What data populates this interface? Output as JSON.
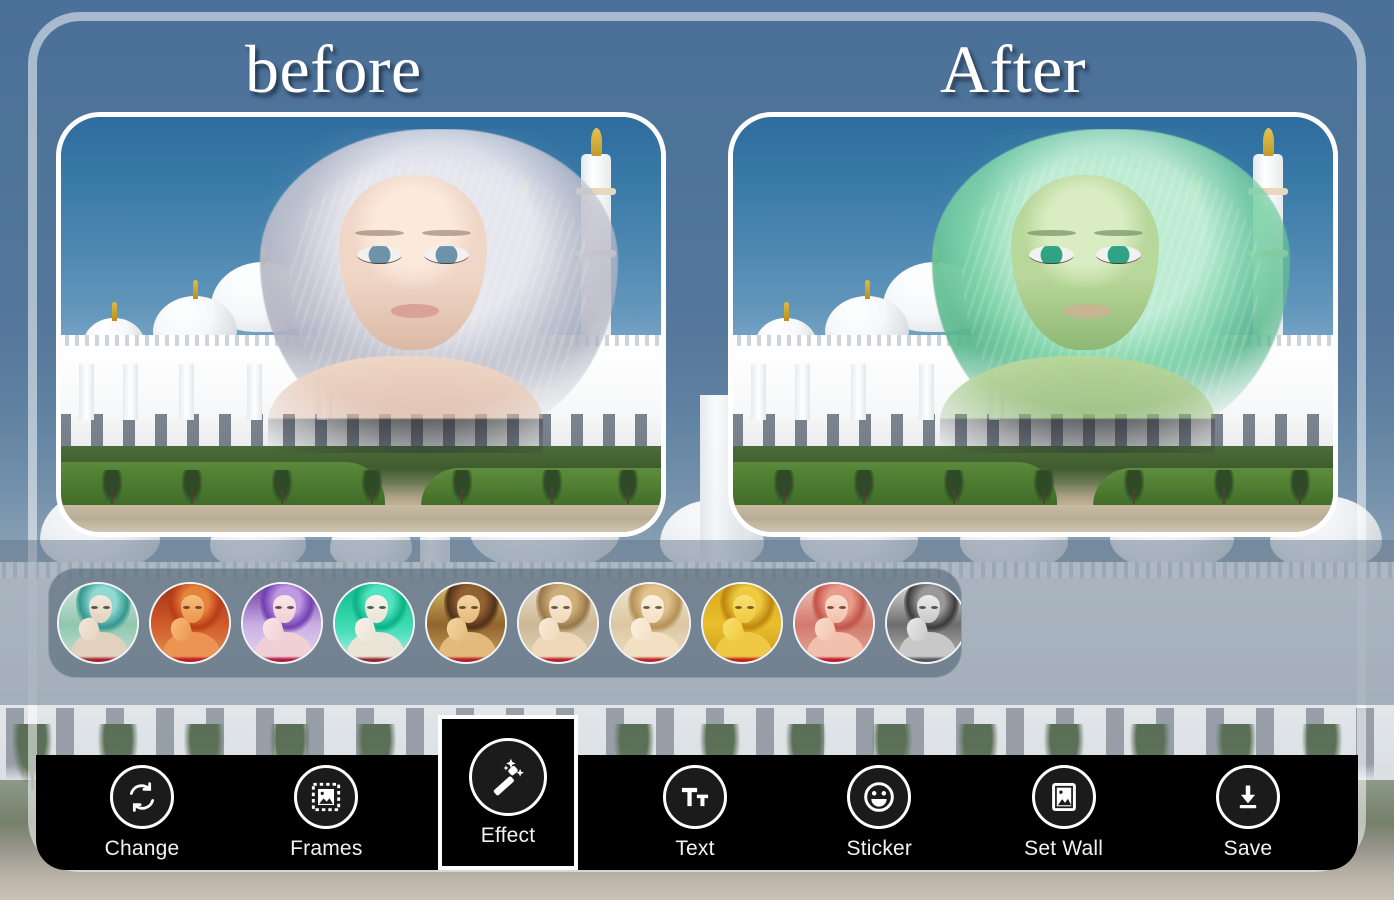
{
  "app": {
    "type": "photo-editor",
    "background_subject": "sheikh-zayed-grand-mosque"
  },
  "headings": {
    "before": "before",
    "after": "After"
  },
  "preview": {
    "left_panel": {
      "name": "before-preview",
      "label": "before",
      "overlay_subject": "woman-portrait",
      "hair_color": "#c6c6d2",
      "filter_applied": "none"
    },
    "right_panel": {
      "name": "after-preview",
      "label": "After",
      "overlay_subject": "woman-portrait",
      "hair_color": "#7fd3a9",
      "filter_applied": "green"
    }
  },
  "filter_strip": {
    "name": "effect-filter-thumbnails",
    "selected_index": 3,
    "items": [
      {
        "id": "filter-1",
        "name": "teal-green",
        "accent": "#6fb6a4"
      },
      {
        "id": "filter-2",
        "name": "warm-rust",
        "accent": "#b8542f"
      },
      {
        "id": "filter-3",
        "name": "violet",
        "accent": "#8a6bbf"
      },
      {
        "id": "filter-4",
        "name": "emerald",
        "accent": "#12b489"
      },
      {
        "id": "filter-5",
        "name": "sepia-brown",
        "accent": "#7d5a33"
      },
      {
        "id": "filter-6",
        "name": "soft-cream",
        "accent": "#c8a87e"
      },
      {
        "id": "filter-7",
        "name": "warm-light",
        "accent": "#d7b68d"
      },
      {
        "id": "filter-8",
        "name": "golden",
        "accent": "#d39b2a"
      },
      {
        "id": "filter-9",
        "name": "rose-pink",
        "accent": "#c9746e"
      },
      {
        "id": "filter-10",
        "name": "black-white",
        "accent": "#8a8a8a"
      }
    ]
  },
  "toolbar": {
    "name": "bottom-toolbar",
    "background": "#000000",
    "active_item": "Effect",
    "items": [
      {
        "id": "change",
        "label": "Change",
        "icon": "refresh-icon"
      },
      {
        "id": "frames",
        "label": "Frames",
        "icon": "frame-photo-icon"
      },
      {
        "id": "effect",
        "label": "Effect",
        "icon": "magic-wand-icon"
      },
      {
        "id": "text",
        "label": "Text",
        "icon": "text-tt-icon"
      },
      {
        "id": "sticker",
        "label": "Sticker",
        "icon": "smiley-icon"
      },
      {
        "id": "set-wall",
        "label": "Set Wall",
        "icon": "wallpaper-image-icon"
      },
      {
        "id": "save",
        "label": "Save",
        "icon": "download-icon"
      }
    ]
  },
  "colors": {
    "toolbar_bg": "#000000",
    "frame_border": "#ffffff",
    "sky": "#4b7099",
    "scrim": "rgba(96,116,136,0.48)"
  }
}
